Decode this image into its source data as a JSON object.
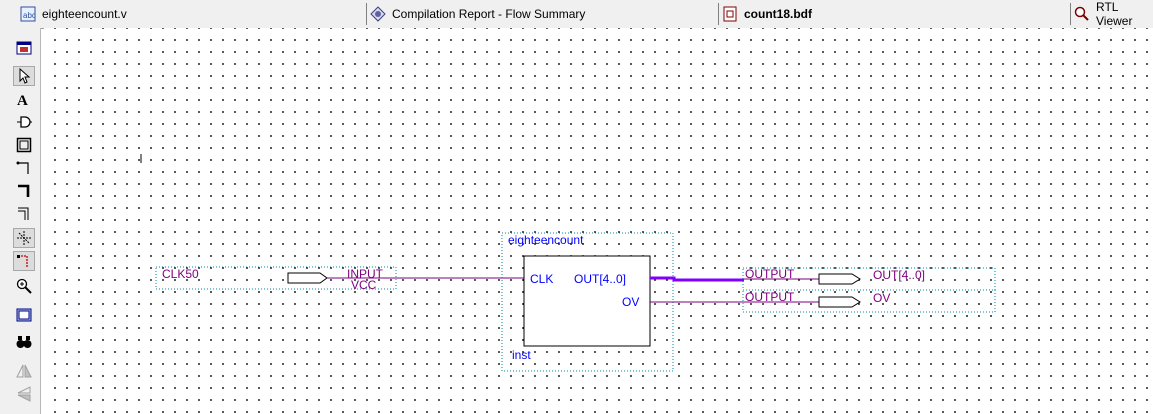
{
  "tabs": [
    {
      "label": "eighteencount.v",
      "icon": "verilog-file-icon",
      "active": false
    },
    {
      "label": "Compilation Report - Flow Summary",
      "icon": "report-icon",
      "active": false
    },
    {
      "label": "count18.bdf",
      "icon": "bdf-file-icon",
      "active": true
    },
    {
      "label": "RTL Viewer",
      "icon": "rtl-viewer-icon",
      "active": false
    }
  ],
  "toolbar": [
    {
      "name": "window-detach-icon"
    },
    {
      "name": "selection-tool-icon"
    },
    {
      "name": "text-tool-icon"
    },
    {
      "name": "symbol-tool-icon"
    },
    {
      "name": "block-tool-icon"
    },
    {
      "name": "orthogonal-node-tool-icon"
    },
    {
      "name": "orthogonal-bus-tool-icon"
    },
    {
      "name": "orthogonal-conduit-tool-icon"
    },
    {
      "name": "use-rubberbanding-icon"
    },
    {
      "name": "partial-line-selection-icon"
    },
    {
      "name": "zoom-tool-icon"
    },
    {
      "name": "full-screen-icon"
    },
    {
      "name": "find-icon"
    },
    {
      "name": "flip-horizontal-icon"
    },
    {
      "name": "flip-vertical-icon"
    }
  ],
  "schematic": {
    "input_pin": {
      "name": "CLK50",
      "type": "INPUT",
      "default": "VCC"
    },
    "block": {
      "name": "eighteencount",
      "instance": "inst",
      "ports": {
        "clk": "CLK",
        "out": "OUT[4..0]",
        "ov": "OV"
      }
    },
    "output_pins": [
      {
        "type": "OUTPUT",
        "name": "OUT[4..0]"
      },
      {
        "type": "OUTPUT",
        "name": "OV"
      }
    ],
    "colors": {
      "wire": "#800080",
      "bus": "#8000ff",
      "pin_text": "#800080",
      "port_text": "#0000ff",
      "frame": "#0088aa"
    }
  }
}
